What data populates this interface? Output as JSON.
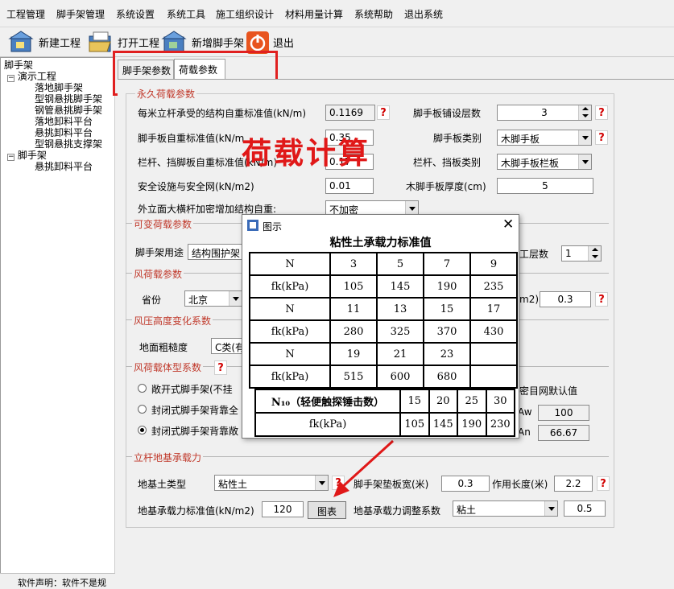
{
  "menu": [
    "工程管理",
    "脚手架管理",
    "系统设置",
    "系统工具",
    "施工组织设计",
    "材料用量计算",
    "系统帮助",
    "退出系统"
  ],
  "toolbar": {
    "new_project": "新建工程",
    "open_project": "打开工程",
    "add_scaffold": "新增脚手架",
    "exit": "退出"
  },
  "tree": {
    "root": "脚手架",
    "project": "演示工程",
    "project_items": [
      "落地脚手架",
      "型钢悬挑脚手架",
      "钢管悬挑脚手架",
      "落地卸料平台",
      "悬挑卸料平台",
      "型钢悬挑支撑架"
    ],
    "group2": "脚手架",
    "group2_items": [
      "悬挑卸料平台"
    ]
  },
  "status_text": "软件声明：软件不是规",
  "tabs": [
    "脚手架参数",
    "荷载参数"
  ],
  "overlay_caption": "荷载计算",
  "permanent": {
    "section": "永久荷载参数",
    "self_weight_label": "每米立杆承受的结构自重标准值(kN/m)",
    "self_weight_value": "0.1169",
    "board_layers_label": "脚手板铺设层数",
    "board_layers_value": "3",
    "board_weight_label": "脚手板自重标准值(kN/m",
    "board_weight_value": "0.35",
    "board_type_label": "脚手板类别",
    "board_type_value": "木脚手板",
    "rail_weight_label": "栏杆、挡脚板自重标准值(kN/m)",
    "rail_weight_value": "0.17",
    "rail_type_label": "栏杆、挡板类别",
    "rail_type_value": "木脚手板栏板",
    "safety_net_label": "安全设施与安全网(kN/m2)",
    "safety_net_value": "0.01",
    "wood_thickness_label": "木脚手板厚度(cm)",
    "wood_thickness_value": "5",
    "crossbar_label": "外立面大横杆加密增加结构自重:",
    "crossbar_value": "不加密"
  },
  "variable": {
    "section": "可变荷载参数",
    "usage_label": "脚手架用途",
    "usage_value": "结构围护架",
    "work_layers_label": "工层数",
    "work_layers_value": "1"
  },
  "wind": {
    "section": "风荷载参数",
    "province_label": "省份",
    "province_value": "北京",
    "pressure_label": "m2)",
    "pressure_value": "0.3"
  },
  "height": {
    "section": "风压高度变化系数",
    "roughness_label": "地面粗糙度",
    "roughness_value": "C类(有"
  },
  "shape": {
    "section": "风荷载体型系数",
    "options": [
      "敞开式脚手架(不挂",
      "封闭式脚手架背靠全",
      "封闭式脚手架背靠敞"
    ],
    "mesh_default_label": "密目网默认值",
    "aw_label": "Aw",
    "aw_value": "100",
    "an_label": "An",
    "an_value": "66.67"
  },
  "foundation": {
    "section": "立杆地基承载力",
    "soil_type_label": "地基土类型",
    "soil_type_value": "粘性土",
    "pad_width_label": "脚手架垫板宽(米)",
    "pad_width_value": "0.3",
    "length_label": "作用长度(米)",
    "length_value": "2.2",
    "bearing_label": "地基承载力标准值(kN/m2)",
    "bearing_value": "120",
    "chart_button": "图表",
    "adjust_label": "地基承载力调整系数",
    "adjust_type": "粘土",
    "adjust_value": "0.5"
  },
  "dialog": {
    "title": "图示",
    "heading": "粘性土承载力标准值",
    "table1": [
      [
        "N",
        "3",
        "5",
        "7",
        "9"
      ],
      [
        "fk(kPa)",
        "105",
        "145",
        "190",
        "235"
      ],
      [
        "N",
        "11",
        "13",
        "15",
        "17"
      ],
      [
        "fk(kPa)",
        "280",
        "325",
        "370",
        "430"
      ],
      [
        "N",
        "19",
        "21",
        "23",
        ""
      ],
      [
        "fk(kPa)",
        "515",
        "600",
        "680",
        ""
      ]
    ],
    "table2_header": "N₁₀（轻便触探锤击数）",
    "table2_values": [
      "15",
      "20",
      "25",
      "30"
    ],
    "table2_unit": "fk(kPa)",
    "table2_fk": [
      "105",
      "145",
      "190",
      "230"
    ]
  }
}
